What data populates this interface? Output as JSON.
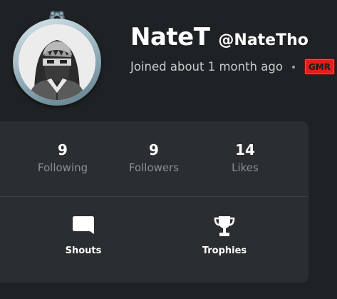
{
  "profile": {
    "display_name": "NateT",
    "handle": "@NateTho",
    "joined": "Joined about 1 month ago",
    "badge": "GMR"
  },
  "stats": [
    {
      "value": "9",
      "label": "Following"
    },
    {
      "value": "9",
      "label": "Followers"
    },
    {
      "value": "14",
      "label": "Likes"
    }
  ],
  "actions": [
    {
      "label": "Shouts",
      "icon": "speech-bubble-icon"
    },
    {
      "label": "Trophies",
      "icon": "trophy-icon"
    }
  ],
  "colors": {
    "background": "#1f2224",
    "card": "#2a2e30",
    "badge": "#e11d1d",
    "muted_text": "#8b9093"
  }
}
